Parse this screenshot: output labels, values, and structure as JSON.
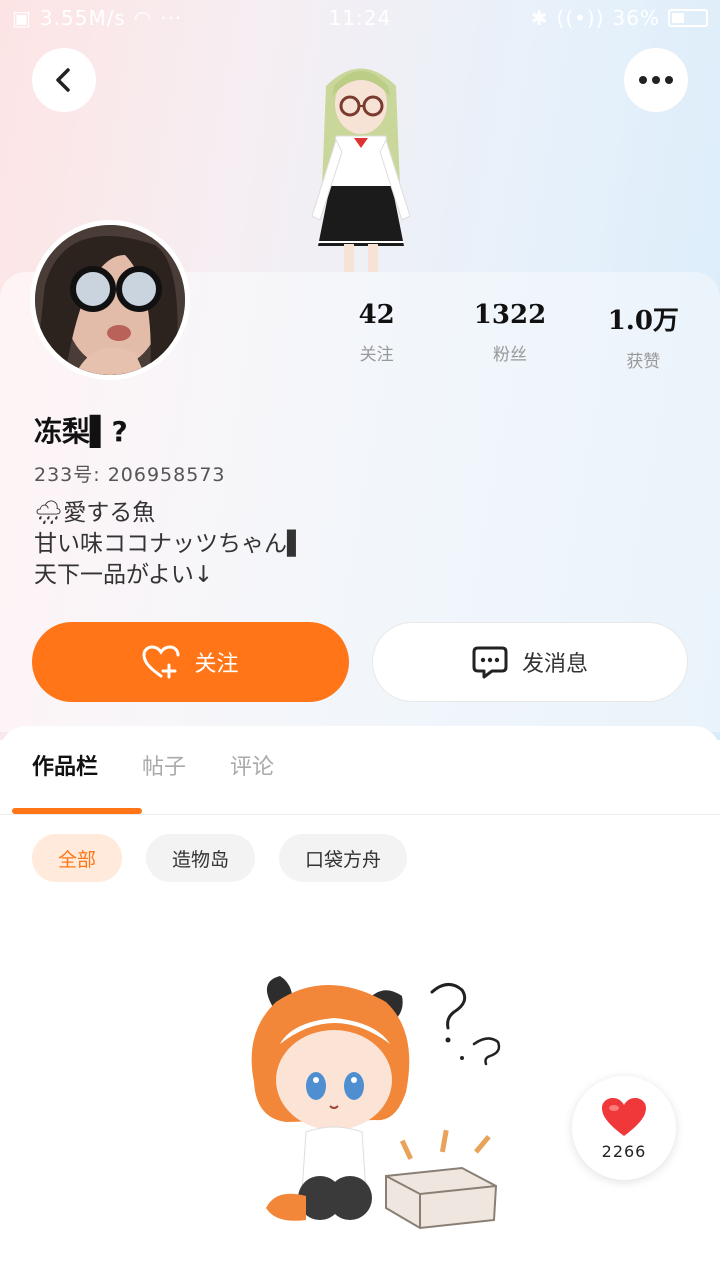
{
  "status_bar": {
    "left": "3.55M/s",
    "time": "11:24",
    "battery": "36%"
  },
  "profile": {
    "nickname": "冻梨▌?",
    "uid": "233号: 206958573",
    "bio": [
      "愛する魚",
      "甘い味ココナッツちゃん▌",
      "天下一品がよい↓"
    ]
  },
  "stats": [
    {
      "value": "42",
      "label": "关注"
    },
    {
      "value": "1322",
      "label": "粉丝"
    },
    {
      "value": "1.0万",
      "label": "获赞"
    }
  ],
  "actions": {
    "follow": "关注",
    "message": "发消息"
  },
  "tabs": [
    "作品栏",
    "帖子",
    "评论"
  ],
  "filters": [
    "全部",
    "造物岛",
    "口袋方舟"
  ],
  "like_count": "2266",
  "colors": {
    "accent": "#ff7518",
    "chip_active_bg": "#ffeadc"
  }
}
